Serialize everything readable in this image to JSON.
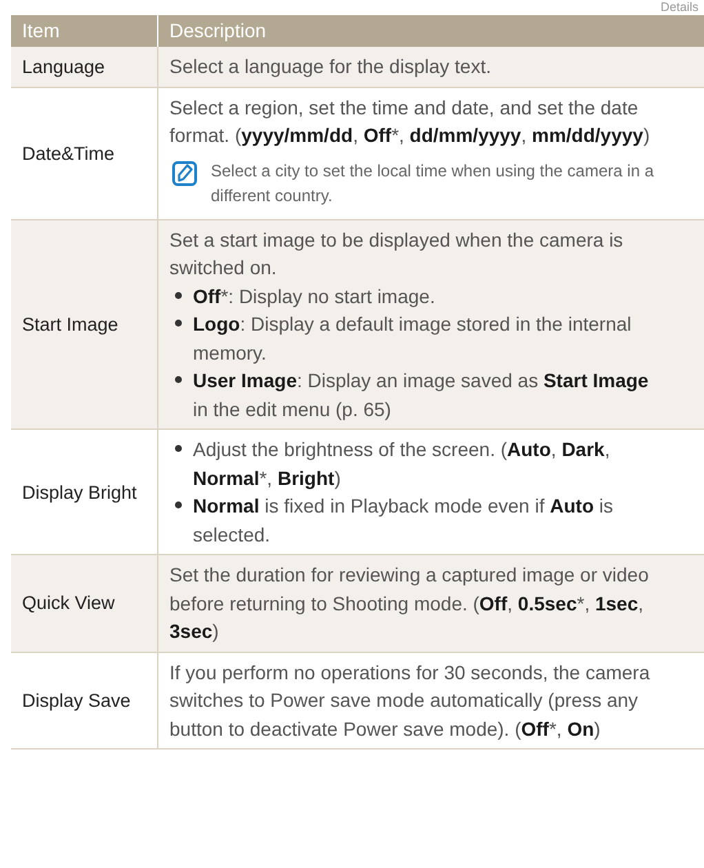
{
  "page_label": "Details",
  "table": {
    "columns": [
      "Item",
      "Description"
    ],
    "rows": [
      {
        "item": "Language",
        "shaded": true,
        "blocks": [
          {
            "kind": "text",
            "text": "Select a language for the display text."
          }
        ]
      },
      {
        "item": "Date&Time",
        "shaded": false,
        "blocks": [
          {
            "kind": "text",
            "text": "Select a region, set the time and date, and set the date format. (**yyyy/mm/dd**, **Off***, **dd/mm/yyyy**, **mm/dd/yyyy**)"
          },
          {
            "kind": "note",
            "text": "Select a city to set the local time when using the camera in a different country."
          }
        ]
      },
      {
        "item": "Start Image",
        "shaded": true,
        "blocks": [
          {
            "kind": "text",
            "text": "Set a start image to be displayed when the camera is switched on."
          },
          {
            "kind": "bullet",
            "text": "**Off***: Display no start image."
          },
          {
            "kind": "bullet",
            "text": "**Logo**: Display a default image stored in the internal memory."
          },
          {
            "kind": "bullet",
            "text": "**User Image**: Display an image saved as **Start Image** in the edit menu (p. 65)"
          }
        ]
      },
      {
        "item": "Display Bright",
        "shaded": false,
        "blocks": [
          {
            "kind": "bullet",
            "text": "Adjust the brightness of the screen. (**Auto**, **Dark**, **Normal***, **Bright**)"
          },
          {
            "kind": "bullet",
            "text": "**Normal** is fixed in Playback mode even if **Auto** is selected."
          }
        ]
      },
      {
        "item": "Quick View",
        "shaded": true,
        "blocks": [
          {
            "kind": "text",
            "text": "Set the duration for reviewing a captured image or video before returning to Shooting mode. (**Off**, **0.5sec***, **1sec**, **3sec**)"
          }
        ]
      },
      {
        "item": "Display Save",
        "shaded": false,
        "blocks": [
          {
            "kind": "text",
            "text": "If you perform no operations for 30 seconds, the camera switches to Power save mode automatically (press any button to deactivate Power save mode). (**Off***, **On**)"
          }
        ]
      }
    ]
  }
}
